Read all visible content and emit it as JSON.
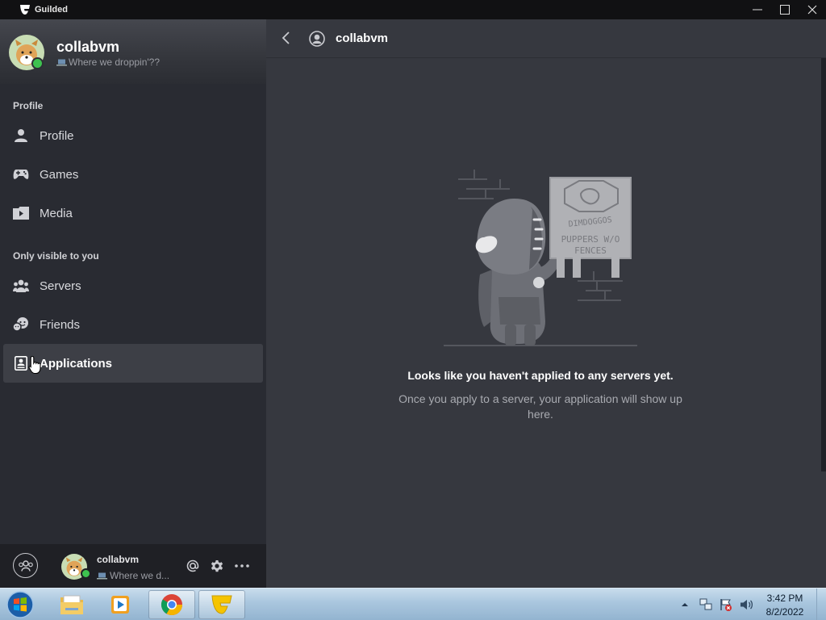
{
  "window": {
    "title": "Guilded"
  },
  "sidebar": {
    "header": {
      "username": "collabvm",
      "status": "Where we droppin'??"
    },
    "sections": [
      {
        "label": "Profile"
      },
      {
        "label": "Only visible to you"
      }
    ],
    "items": [
      {
        "label": "Profile",
        "icon": "person-icon"
      },
      {
        "label": "Games",
        "icon": "gamepad-icon"
      },
      {
        "label": "Media",
        "icon": "media-icon"
      },
      {
        "label": "Servers",
        "icon": "servers-icon"
      },
      {
        "label": "Friends",
        "icon": "friends-icon"
      },
      {
        "label": "Applications",
        "icon": "applications-icon",
        "active": true
      }
    ]
  },
  "footer": {
    "username": "collabvm",
    "status": "Where we d..."
  },
  "main": {
    "title": "collabvm",
    "empty_state": {
      "illustration_sign": [
        "DIMDOGGOS",
        "PUPPERS W/O",
        "FENCES"
      ],
      "title": "Looks like you haven't applied to any servers yet.",
      "description": "Once you apply to a server, your application will show up here."
    }
  },
  "taskbar": {
    "apps": [
      "Windows Explorer",
      "Windows Media Player",
      "Google Chrome",
      "Guilded"
    ],
    "clock": {
      "time": "3:42 PM",
      "date": "8/2/2022"
    }
  },
  "colors": {
    "sidebar_bg": "#292b32",
    "main_bg": "#36383f",
    "accent_yellow": "#f5c400",
    "online_green": "#3ec24f"
  }
}
